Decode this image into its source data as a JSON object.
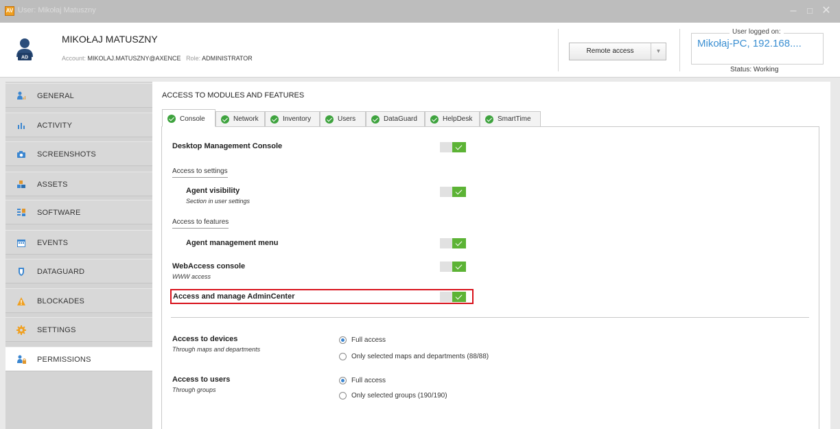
{
  "window": {
    "app_icon": "AV",
    "title": "User: Mikołaj Matuszny",
    "minimize_icon": "minimize-icon",
    "maximize_icon": "maximize-icon",
    "close_icon": "close-icon"
  },
  "header": {
    "name": "MIKOŁAJ MATUSZNY",
    "account_label": "Account:",
    "account_value": "MIKOLAJ.MATUSZNY@AXENCE",
    "role_label": "Role:",
    "role_value": "ADMINISTRATOR",
    "avatar_badge": "AD",
    "remote_access_label": "Remote access",
    "logged_on_label": "User logged on:",
    "logged_on_host": "Mikołaj-PC, 192.168....",
    "status": "Status: Working"
  },
  "sidebar": {
    "items": [
      {
        "label": "GENERAL",
        "icon": "user-chart-icon"
      },
      {
        "label": "ACTIVITY",
        "icon": "bar-chart-icon"
      },
      {
        "label": "SCREENSHOTS",
        "icon": "camera-icon"
      },
      {
        "label": "ASSETS",
        "icon": "assets-icon"
      },
      {
        "label": "SOFTWARE",
        "icon": "software-icon"
      },
      {
        "label": "EVENTS",
        "icon": "calendar-icon"
      },
      {
        "label": "DATAGUARD",
        "icon": "shield-icon"
      },
      {
        "label": "BLOCKADES",
        "icon": "warning-icon"
      },
      {
        "label": "SETTINGS",
        "icon": "gear-icon"
      },
      {
        "label": "PERMISSIONS",
        "icon": "user-lock-icon"
      }
    ],
    "active": "PERMISSIONS"
  },
  "main": {
    "section_title": "ACCESS TO MODULES AND FEATURES",
    "tabs": [
      "Console",
      "Network",
      "Inventory",
      "Users",
      "DataGuard",
      "HelpDesk",
      "SmartTime"
    ],
    "active_tab": "Console",
    "rows": {
      "desktop_console": {
        "title": "Desktop Management Console",
        "enabled": true
      },
      "settings_group": "Access to settings",
      "agent_visibility": {
        "title": "Agent visibility",
        "sub": "Section in user settings",
        "enabled": true
      },
      "features_group": "Access to features",
      "agent_menu": {
        "title": "Agent management menu",
        "enabled": true
      },
      "webaccess": {
        "title": "WebAccess console",
        "sub": "WWW access",
        "enabled": true
      },
      "admincenter": {
        "title": "Access and manage AdminCenter",
        "enabled": true
      }
    },
    "devices": {
      "title": "Access to devices",
      "sub": "Through maps and departments",
      "option_full": "Full access",
      "option_selected": "Only selected maps and departments (88/88)",
      "selected": "Full access"
    },
    "users": {
      "title": "Access to users",
      "sub": "Through groups",
      "option_full": "Full access",
      "option_selected": "Only selected groups (190/190)",
      "selected": "Full access"
    }
  }
}
